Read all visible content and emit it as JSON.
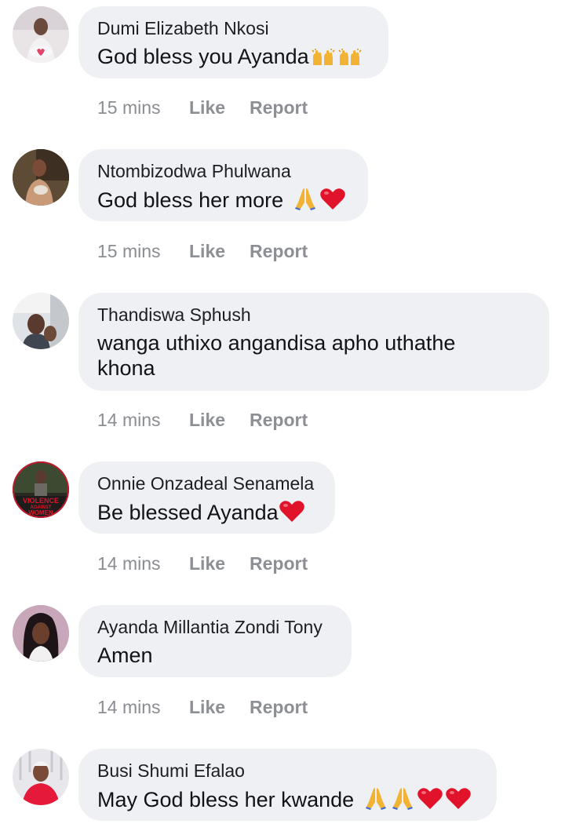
{
  "comments": [
    {
      "author": "Dumi Elizabeth Nkosi",
      "text": "God bless you Ayanda",
      "emojis": [
        "raising-hands-icon",
        "raising-hands-icon"
      ],
      "time": "15 mins",
      "like": "Like",
      "report": "Report"
    },
    {
      "author": "Ntombizodwa Phulwana",
      "text": "God bless her more ",
      "emojis": [
        "praying-hands-icon",
        "red-heart-icon"
      ],
      "time": "15 mins",
      "like": "Like",
      "report": "Report"
    },
    {
      "author": "Thandiswa Sphush",
      "text": "wanga uthixo angandisa apho uthathe khona",
      "emojis": [],
      "time": "14 mins",
      "like": "Like",
      "report": "Report"
    },
    {
      "author": "Onnie Onzadeal Senamela",
      "text": "Be blessed Ayanda",
      "emojis": [
        "red-heart-icon"
      ],
      "time": "14 mins",
      "like": "Like",
      "report": "Report",
      "avatar_text": [
        "VIOLENCE",
        "AGAINST",
        "WOMEN"
      ]
    },
    {
      "author": "Ayanda Millantia Zondi Tony",
      "text": "Amen",
      "emojis": [],
      "time": "14 mins",
      "like": "Like",
      "report": "Report"
    },
    {
      "author": "Busi Shumi Efalao",
      "text": "May God bless her kwande ",
      "emojis": [
        "praying-hands-icon",
        "praying-hands-icon",
        "red-heart-icon",
        "red-heart-icon"
      ],
      "time": "",
      "like": "",
      "report": ""
    }
  ],
  "colors": {
    "bubble": "#eff0f3",
    "meta": "#8a8d91",
    "heart": "#e0132b",
    "praying": "#f2b233"
  }
}
